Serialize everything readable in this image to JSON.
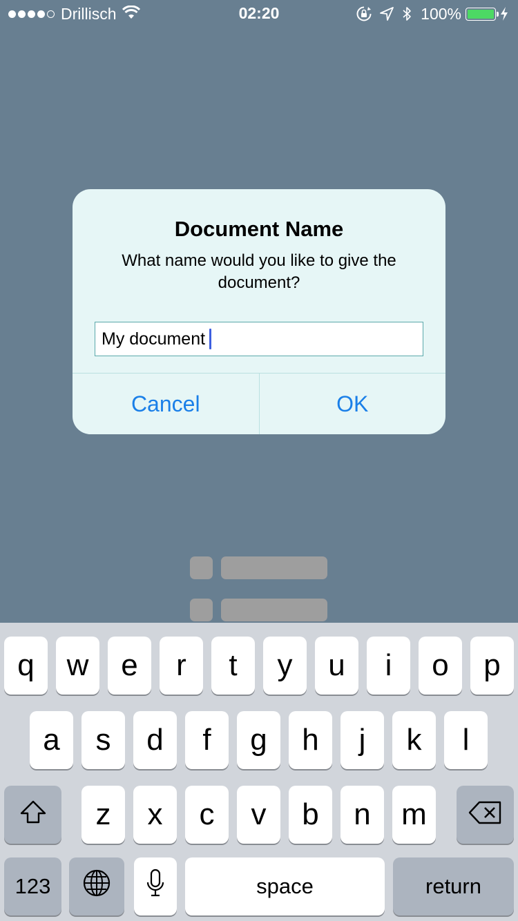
{
  "status_bar": {
    "carrier": "Drillisch",
    "signal_bars": 4,
    "time": "02:20",
    "battery_percent": "100%",
    "battery_level": 1.0,
    "battery_color": "#4cd964"
  },
  "dialog": {
    "title": "Document Name",
    "message": "What name would you like to give the document?",
    "input_value": "My document",
    "cancel_label": "Cancel",
    "ok_label": "OK",
    "button_color": "#1a7fe8"
  },
  "keyboard": {
    "row1": [
      "q",
      "w",
      "e",
      "r",
      "t",
      "y",
      "u",
      "i",
      "o",
      "p"
    ],
    "row2": [
      "a",
      "s",
      "d",
      "f",
      "g",
      "h",
      "j",
      "k",
      "l"
    ],
    "row3": [
      "z",
      "x",
      "c",
      "v",
      "b",
      "n",
      "m"
    ],
    "numbers_label": "123",
    "space_label": "space",
    "return_label": "return",
    "icons": [
      "shift-icon",
      "backspace-icon",
      "globe-icon",
      "microphone-icon"
    ]
  }
}
